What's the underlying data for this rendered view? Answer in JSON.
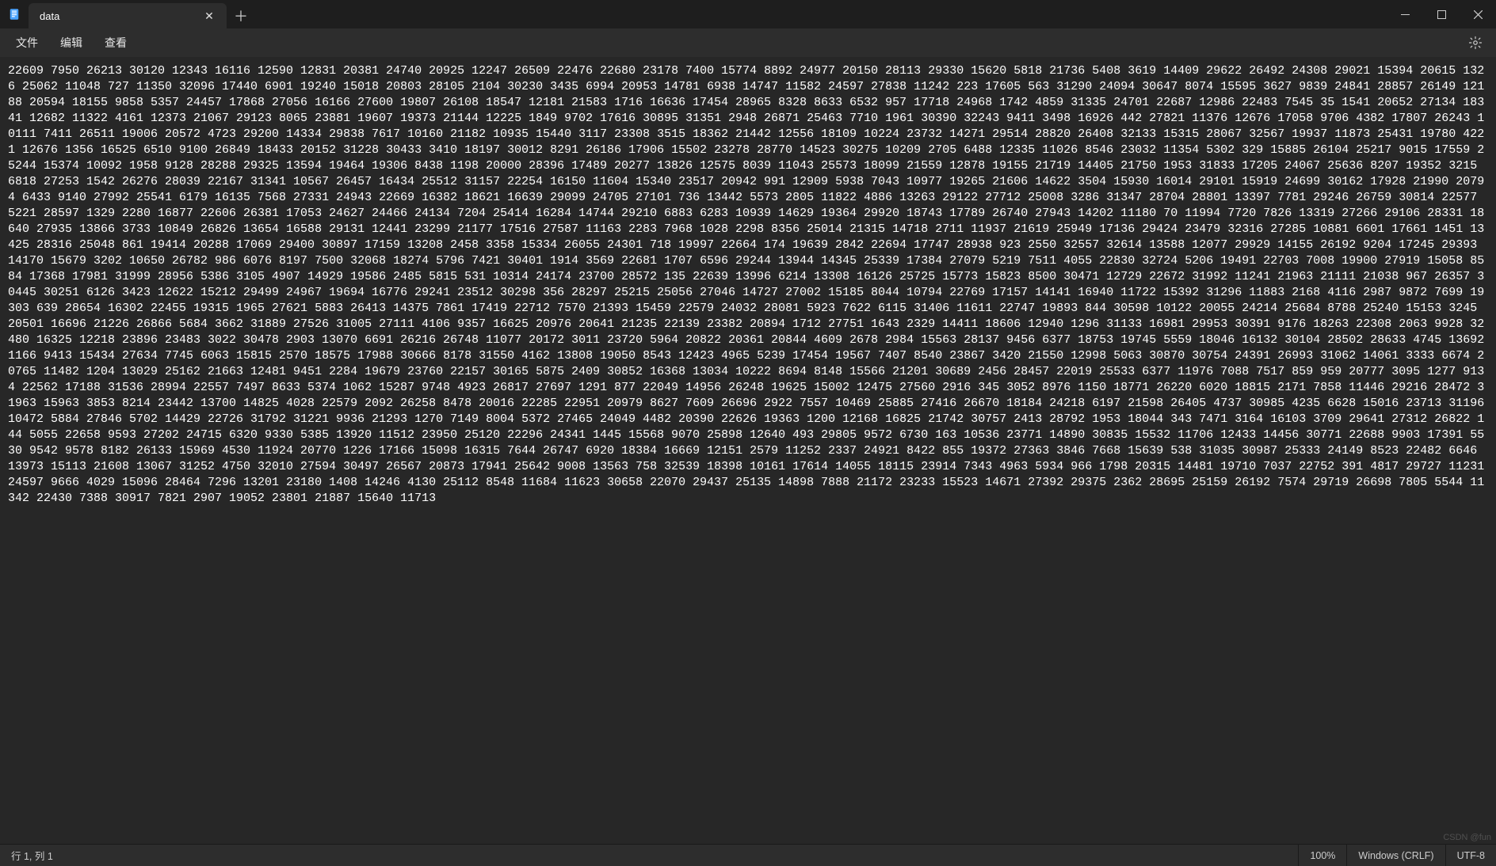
{
  "tab": {
    "title": "data"
  },
  "menu": {
    "file": "文件",
    "edit": "编辑",
    "view": "查看"
  },
  "content": "22609 7950 26213 30120 12343 16116 12590 12831 20381 24740 20925 12247 26509 22476 22680 23178 7400 15774 8892 24977 20150 28113 29330 15620 5818 21736 5408 3619 14409 29622 26492 24308 29021 15394 20615 1326 25062 11048 727 11350 32096 17440 6901 19240 15018 20803 28105 2104 30230 3435 6994 20953 14781 6938 14747 11582 24597 27838 11242 223 17605 563 31290 24094 30647 8074 15595 3627 9839 24841 28857 26149 12188 20594 18155 9858 5357 24457 17868 27056 16166 27600 19807 26108 18547 12181 21583 1716 16636 17454 28965 8328 8633 6532 957 17718 24968 1742 4859 31335 24701 22687 12986 22483 7545 35 1541 20652 27134 18341 12682 11322 4161 12373 21067 29123 8065 23881 19607 19373 21144 12225 1849 9702 17616 30895 31351 2948 26871 25463 7710 1961 30390 32243 9411 3498 16926 442 27821 11376 12676 17058 9706 4382 17807 26243 10111 7411 26511 19006 20572 4723 29200 14334 29838 7617 10160 21182 10935 15440 3117 23308 3515 18362 21442 12556 18109 10224 23732 14271 29514 28820 26408 32133 15315 28067 32567 19937 11873 25431 19780 4221 12676 1356 16525 6510 9100 26849 18433 20152 31228 30433 3410 18197 30012 8291 26186 17906 15502 23278 28770 14523 30275 10209 2705 6488 12335 11026 8546 23032 11354 5302 329 15885 26104 25217 9015 17559 25244 15374 10092 1958 9128 28288 29325 13594 19464 19306 8438 1198 20000 28396 17489 20277 13826 12575 8039 11043 25573 18099 21559 12878 19155 21719 14405 21750 1953 31833 17205 24067 25636 8207 19352 3215 6818 27253 1542 26276 28039 22167 31341 10567 26457 16434 25512 31157 22254 16150 11604 15340 23517 20942 991 12909 5938 7043 10977 19265 21606 14622 3504 15930 16014 29101 15919 24699 30162 17928 21990 20794 6433 9140 27992 25541 6179 16135 7568 27331 24943 22669 16382 18621 16639 29099 24705 27101 736 13442 5573 2805 11822 4886 13263 29122 27712 25008 3286 31347 28704 28801 13397 7781 29246 26759 30814 22577 5221 28597 1329 2280 16877 22606 26381 17053 24627 24466 24134 7204 25414 16284 14744 29210 6883 6283 10939 14629 19364 29920 18743 17789 26740 27943 14202 11180 70 11994 7720 7826 13319 27266 29106 28331 18640 27935 13866 3733 10849 26826 13654 16588 29131 12441 23299 21177 17516 27587 11163 2283 7968 1028 2298 8356 25014 21315 14718 2711 11937 21619 25949 17136 29424 23479 32316 27285 10881 6601 17661 1451 13425 28316 25048 861 19414 20288 17069 29400 30897 17159 13208 2458 3358 15334 26055 24301 718 19997 22664 174 19639 2842 22694 17747 28938 923 2550 32557 32614 13588 12077 29929 14155 26192 9204 17245 29393 14170 15679 3202 10650 26782 986 6076 8197 7500 32068 18274 5796 7421 30401 1914 3569 22681 1707 6596 29244 13944 14345 25339 17384 27079 5219 7511 4055 22830 32724 5206 19491 22703 7008 19900 27919 15058 8584 17368 17981 31999 28956 5386 3105 4907 14929 19586 2485 5815 531 10314 24174 23700 28572 135 22639 13996 6214 13308 16126 25725 15773 15823 8500 30471 12729 22672 31992 11241 21963 21111 21038 967 26357 30445 30251 6126 3423 12622 15212 29499 24967 19694 16776 29241 23512 30298 356 28297 25215 25056 27046 14727 27002 15185 8044 10794 22769 17157 14141 16940 11722 15392 31296 11883 2168 4116 2987 9872 7699 19303 639 28654 16302 22455 19315 1965 27621 5883 26413 14375 7861 17419 22712 7570 21393 15459 22579 24032 28081 5923 7622 6115 31406 11611 22747 19893 844 30598 10122 20055 24214 25684 8788 25240 15153 3245 20501 16696 21226 26866 5684 3662 31889 27526 31005 27111 4106 9357 16625 20976 20641 21235 22139 23382 20894 1712 27751 1643 2329 14411 18606 12940 1296 31133 16981 29953 30391 9176 18263 22308 2063 9928 32480 16325 12218 23896 23483 3022 30478 2903 13070 6691 26216 26748 11077 20172 3011 23720 5964 20822 20361 20844 4609 2678 2984 15563 28137 9456 6377 18753 19745 5559 18046 16132 30104 28502 28633 4745 13692 1166 9413 15434 27634 7745 6063 15815 2570 18575 17988 30666 8178 31550 4162 13808 19050 8543 12423 4965 5239 17454 19567 7407 8540 23867 3420 21550 12998 5063 30870 30754 24391 26993 31062 14061 3333 6674 20765 11482 1204 13029 25162 21663 12481 9451 2284 19679 23760 22157 30165 5875 2409 30852 16368 13034 10222 8694 8148 15566 21201 30689 2456 28457 22019 25533 6377 11976 7088 7517 859 959 20777 3095 1277 9134 22562 17188 31536 28994 22557 7497 8633 5374 1062 15287 9748 4923 26817 27697 1291 877 22049 14956 26248 19625 15002 12475 27560 2916 345 3052 8976 1150 18771 26220 6020 18815 2171 7858 11446 29216 28472 31963 15963 3853 8214 23442 13700 14825 4028 22579 2092 26258 8478 20016 22285 22951 20979 8627 7609 26696 2922 7557 10469 25885 27416 26670 18184 24218 6197 21598 26405 4737 30985 4235 6628 15016 23713 31196 10472 5884 27846 5702 14429 22726 31792 31221 9936 21293 1270 7149 8004 5372 27465 24049 4482 20390 22626 19363 1200 12168 16825 21742 30757 2413 28792 1953 18044 343 7471 3164 16103 3709 29641 27312 26822 144 5055 22658 9593 27202 24715 6320 9330 5385 13920 11512 23950 25120 22296 24341 1445 15568 9070 25898 12640 493 29805 9572 6730 163 10536 23771 14890 30835 15532 11706 12433 14456 30771 22688 9903 17391 5530 9542 9578 8182 26133 15969 4530 11924 20770 1226 17166 15098 16315 7644 26747 6920 18384 16669 12151 2579 11252 2337 24921 8422 855 19372 27363 3846 7668 15639 538 31035 30987 25333 24149 8523 22482 6646 13973 15113 21608 13067 31252 4750 32010 27594 30497 26567 20873 17941 25642 9008 13563 758 32539 18398 10161 17614 14055 18115 23914 7343 4963 5934 966 1798 20315 14481 19710 7037 22752 391 4817 29727 11231 24597 9666 4029 15096 28464 7296 13201 23180 1408 14246 4130 25112 8548 11684 11623 30658 22070 29437 25135 14898 7888 21172 23233 15523 14671 27392 29375 2362 28695 25159 26192 7574 29719 26698 7805 5544 11342 22430 7388 30917 7821 2907 19052 23801 21887 15640 11713",
  "status": {
    "pos": "行 1, 列 1",
    "zoom": "100%",
    "eol": "Windows (CRLF)",
    "encoding": "UTF-8"
  },
  "watermark": "CSDN @fun"
}
